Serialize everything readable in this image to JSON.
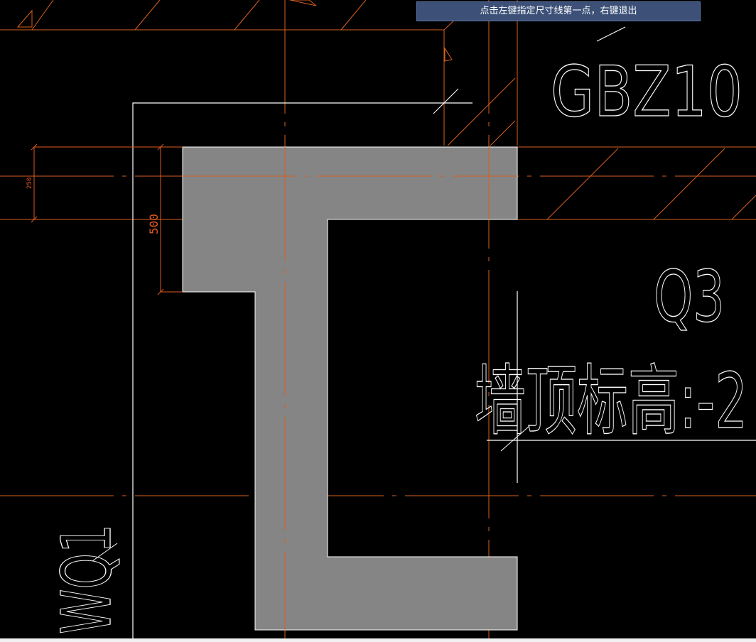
{
  "status_tip": "点击左键指定尺寸线第一点，右键退出",
  "drawing": {
    "labels": {
      "column_tag": "GBZ10",
      "wall_tag_q3": "Q3",
      "wall_top_elevation": "墙顶标高:-2",
      "wall_tag_wq1": "WQ1"
    },
    "dimensions": {
      "small": "250",
      "main": "500"
    }
  },
  "colors": {
    "background": "#000000",
    "wall_outline": "#ffffff",
    "column_fill": "#858585",
    "axis_line": "#e05a1e",
    "tip_bar": "#3d5178"
  }
}
